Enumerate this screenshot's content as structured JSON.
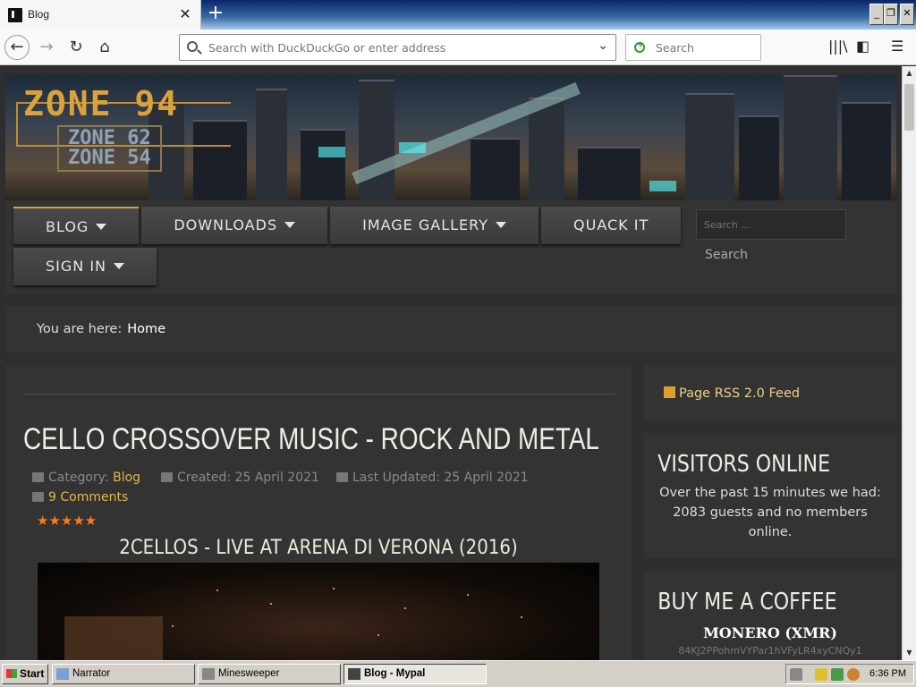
{
  "browser": {
    "tab_title": "Blog",
    "url_placeholder": "Search with DuckDuckGo or enter address",
    "search_placeholder": "Search",
    "new_tab": "+",
    "close_tab": "✕"
  },
  "site": {
    "logo_main": "ZONE 94",
    "logo_sub1": "ZONE 62",
    "logo_sub2": "ZONE 54",
    "menu": [
      {
        "label": "BLOG",
        "dropdown": true
      },
      {
        "label": "DOWNLOADS",
        "dropdown": true
      },
      {
        "label": "IMAGE GALLERY",
        "dropdown": true
      },
      {
        "label": "QUACK IT",
        "dropdown": false
      },
      {
        "label": "SIGN IN",
        "dropdown": true
      }
    ],
    "search_placeholder": "Search ...",
    "search_button": "Search",
    "breadcrumb_prefix": "You are here:",
    "breadcrumb_home": "Home"
  },
  "article": {
    "title": "CELLO CROSSOVER MUSIC - ROCK AND METAL",
    "category_label": "Category:",
    "category": "Blog",
    "created": "Created: 25 April 2021",
    "updated": "Last Updated: 25 April 2021",
    "comments": "9 Comments",
    "rating_stars": "★★★★★",
    "video_title": "2CELLOS - LIVE AT ARENA DI VERONA (2016)"
  },
  "sidebar": {
    "rss": "Page RSS 2.0 Feed",
    "visitors_title": "VISITORS ONLINE",
    "visitors_text": "Over the past 15 minutes we had: 2083 guests and no members online.",
    "coffee_title": "BUY ME A COFFEE",
    "monero_label": "MONERO (XMR)",
    "monero_address": "84KJ2PPohmVYPar1hVFyLR4xyCNQy1"
  },
  "taskbar": {
    "start": "Start",
    "tasks": [
      "Narrator",
      "Minesweeper",
      "Blog - Mypal"
    ],
    "clock": "6:36 PM"
  }
}
